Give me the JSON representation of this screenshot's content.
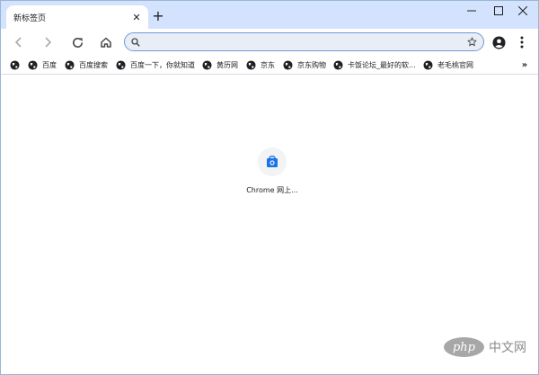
{
  "tab": {
    "title": "新标签页",
    "close": "✕"
  },
  "new_tab": "+",
  "omnibox": {
    "value": "",
    "placeholder": ""
  },
  "bookmarks": [
    {
      "label": ""
    },
    {
      "label": "百度"
    },
    {
      "label": "百度搜索"
    },
    {
      "label": "百度一下，你就知道"
    },
    {
      "label": "黄历网"
    },
    {
      "label": "京东"
    },
    {
      "label": "京东购物"
    },
    {
      "label": "卡饭论坛_最好的软..."
    },
    {
      "label": "老毛桃官网"
    }
  ],
  "bookmarks_more": "»",
  "shortcut_tile": {
    "label": "Chrome 网上..."
  },
  "watermark": {
    "logo_text": "php",
    "text": "中文网"
  },
  "colors": {
    "tabstrip": "#d3e3fd",
    "omnibox": "#e9eef6",
    "accent": "#1a73e8"
  },
  "icons": [
    "back-icon",
    "forward-icon",
    "reload-icon",
    "home-icon",
    "search-icon",
    "star-icon",
    "profile-icon",
    "menu-icon",
    "globe-icon",
    "minimize-icon",
    "maximize-icon",
    "close-icon"
  ]
}
